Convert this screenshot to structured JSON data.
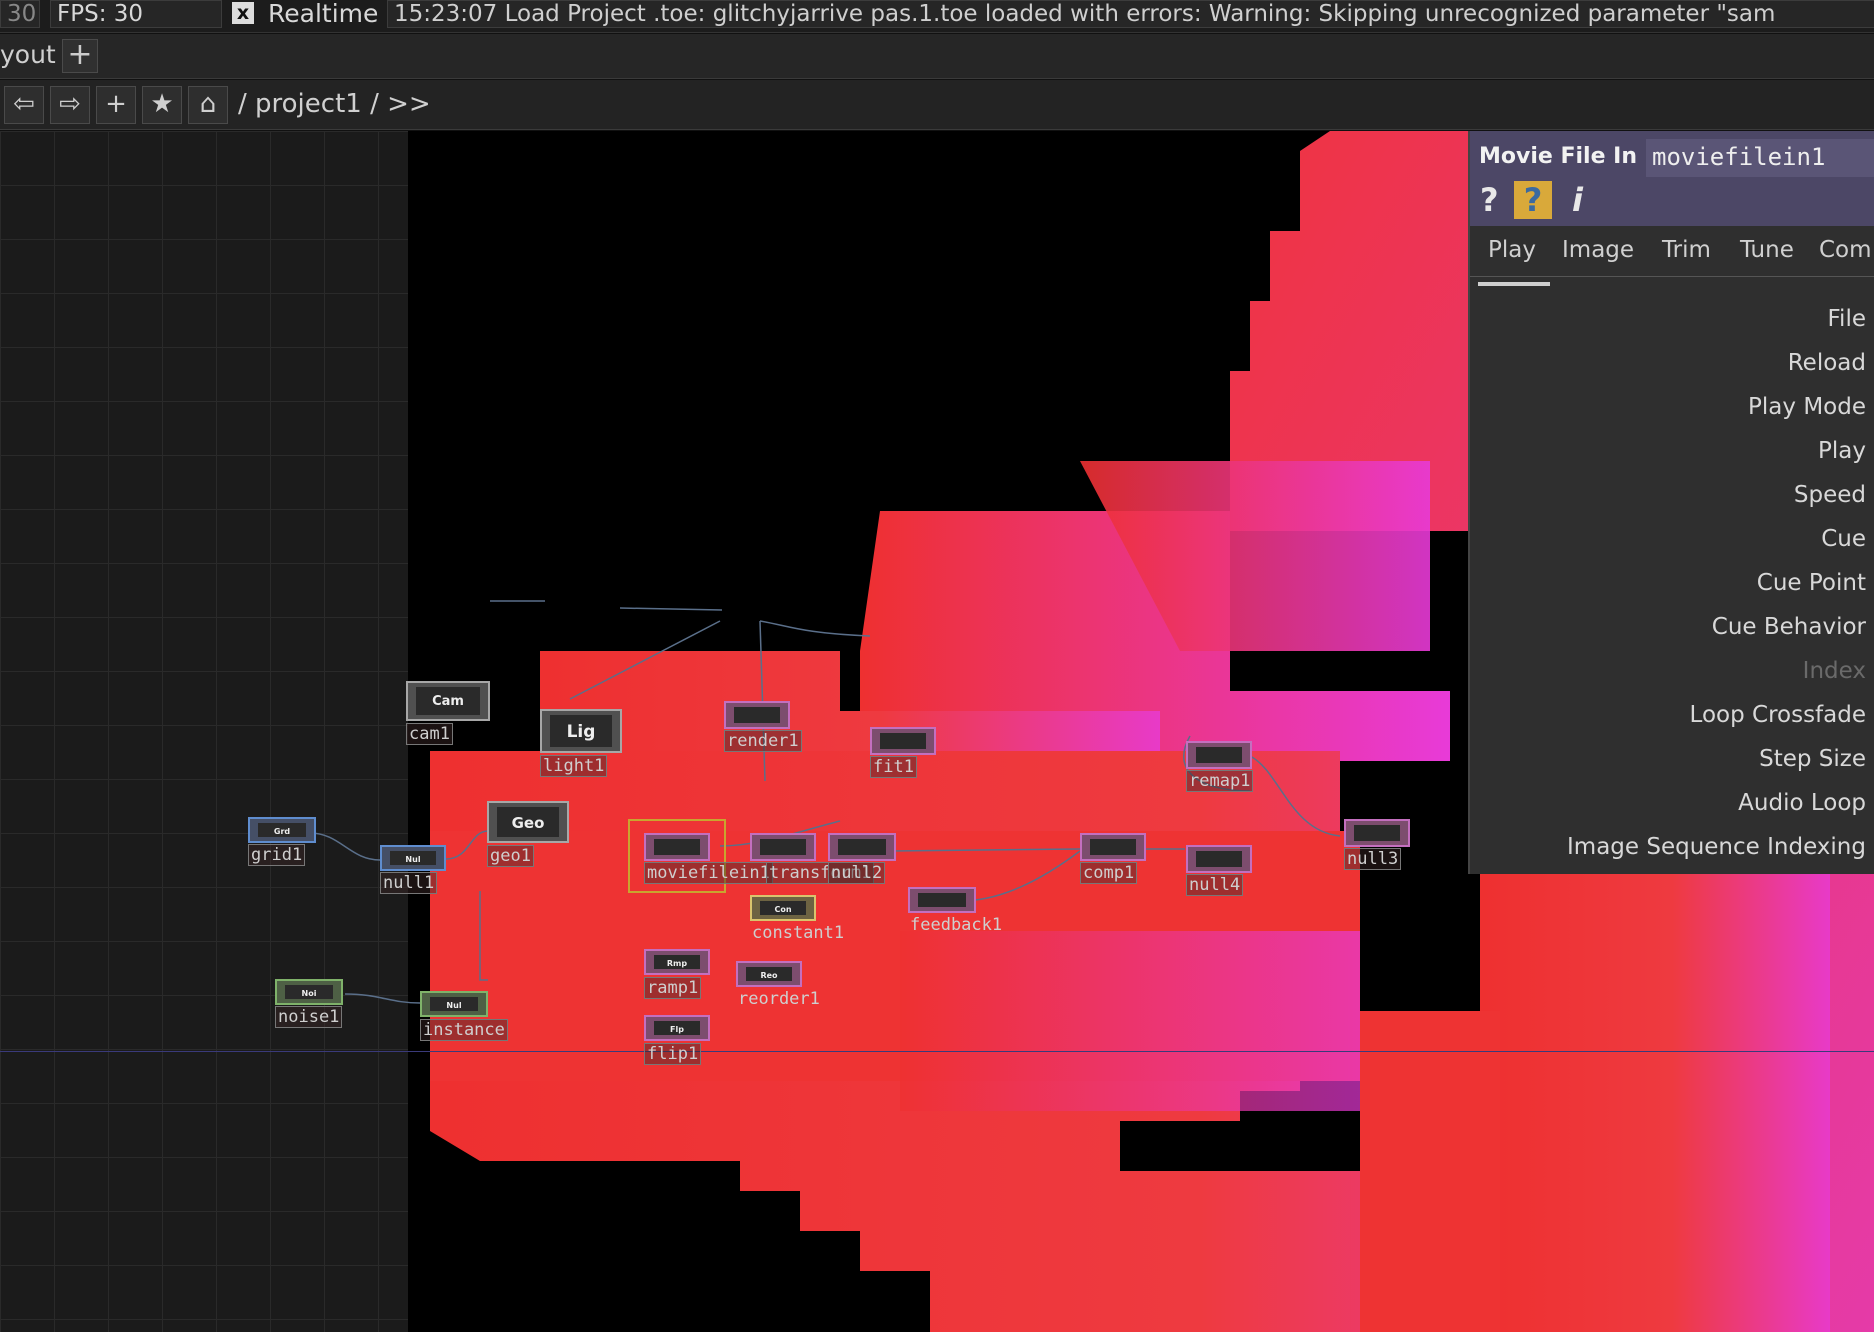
{
  "topbar": {
    "frame": "30",
    "fps": "FPS:  30",
    "realtime_check": "x",
    "realtime_label": "Realtime",
    "console": "15:23:07 Load Project .toe: glitchyjarrive pas.1.toe loaded with errors:  Warning: Skipping unrecognized parameter \"sam"
  },
  "layoutbar": {
    "label": "yout",
    "add": "+"
  },
  "pathbar": {
    "back_icon": "arrow-left-icon",
    "forward_icon": "arrow-right-icon",
    "add_icon": "plus-icon",
    "star_icon": "star-icon",
    "home_icon": "home-icon",
    "back": "⇦",
    "forward": "⇨",
    "add": "+",
    "star": "★",
    "home": "⌂",
    "crumb": "/ project1 / >>"
  },
  "nodes": {
    "cam": {
      "icon": "Cam",
      "label": "cam1"
    },
    "light": {
      "icon": "Lig",
      "label": "light1"
    },
    "geo": {
      "icon": "Geo",
      "label": "geo1"
    },
    "grid": {
      "icon": "Grd",
      "label": "grid1"
    },
    "null1": {
      "icon": "Nul",
      "label": "null1"
    },
    "noise": {
      "icon": "Noi",
      "label": "noise1"
    },
    "instance": {
      "icon": "Nul",
      "label": "instance"
    },
    "render": {
      "label": "render1"
    },
    "fit": {
      "label": "fit1"
    },
    "moviefilein": {
      "label": "moviefilein1"
    },
    "transform": {
      "label": "transform1"
    },
    "null2": {
      "label": "null2"
    },
    "constant": {
      "icon": "Con",
      "label": "constant1"
    },
    "ramp": {
      "icon": "Rmp",
      "label": "ramp1"
    },
    "reorder": {
      "icon": "Reo",
      "label": "reorder1"
    },
    "flip": {
      "icon": "Flp",
      "label": "flip1"
    },
    "feedback": {
      "label": "feedback1"
    },
    "comp": {
      "label": "comp1"
    },
    "remap": {
      "label": "remap1"
    },
    "null4": {
      "label": "null4"
    },
    "null3": {
      "label": "null3"
    }
  },
  "params": {
    "op_type": "Movie File In",
    "op_name": "moviefilein1",
    "help_icon": "help-icon",
    "python_help_icon": "python-help-icon",
    "info_icon": "info-icon",
    "help": "?",
    "info": "i",
    "tabs": [
      "Play",
      "Image",
      "Trim",
      "Tune",
      "Com"
    ],
    "rows": [
      "File",
      "Reload",
      "Play Mode",
      "Play",
      "Speed",
      "Cue",
      "Cue Point",
      "Cue Behavior",
      "Index",
      "Loop Crossfade",
      "Step Size",
      "Audio Loop",
      "Image Sequence Indexing"
    ]
  },
  "colors": {
    "background_red": "#ee3030",
    "background_magenta": "#e83ac8",
    "panel_header": "#4c4766",
    "selection": "#c9a52f"
  }
}
